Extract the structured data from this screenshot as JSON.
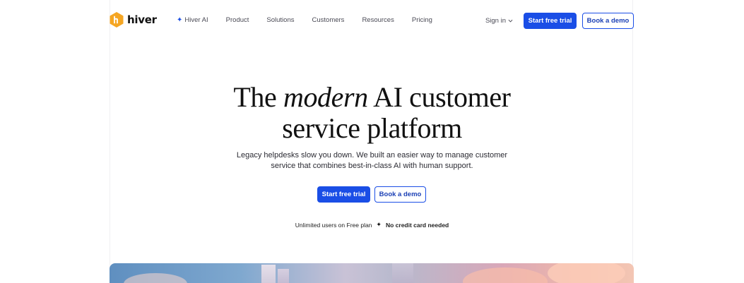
{
  "brand": {
    "name": "hiver",
    "logo_icon": "hiver-hexagon-logo",
    "accent": "#1a4ee6",
    "logo_color": "#f5a623"
  },
  "nav": {
    "links": [
      {
        "label": "Hiver AI",
        "icon": "sparkle-icon"
      },
      {
        "label": "Product"
      },
      {
        "label": "Solutions"
      },
      {
        "label": "Customers"
      },
      {
        "label": "Resources"
      },
      {
        "label": "Pricing"
      }
    ],
    "signin_label": "Sign in",
    "cta_primary": "Start free trial",
    "cta_secondary": "Book a demo"
  },
  "hero": {
    "title_before": "The ",
    "title_emphasis": "modern",
    "title_after": " AI customer",
    "title_line2": "service platform",
    "subtitle_line1": "Legacy helpdesks slow you down. We built an easier way to manage customer",
    "subtitle_line2": "service that combines best-in-class AI with human support.",
    "cta_primary": "Start free trial",
    "cta_secondary": "Book a demo",
    "note_left": "Unlimited users on Free plan",
    "note_right": "No credit card needed"
  }
}
